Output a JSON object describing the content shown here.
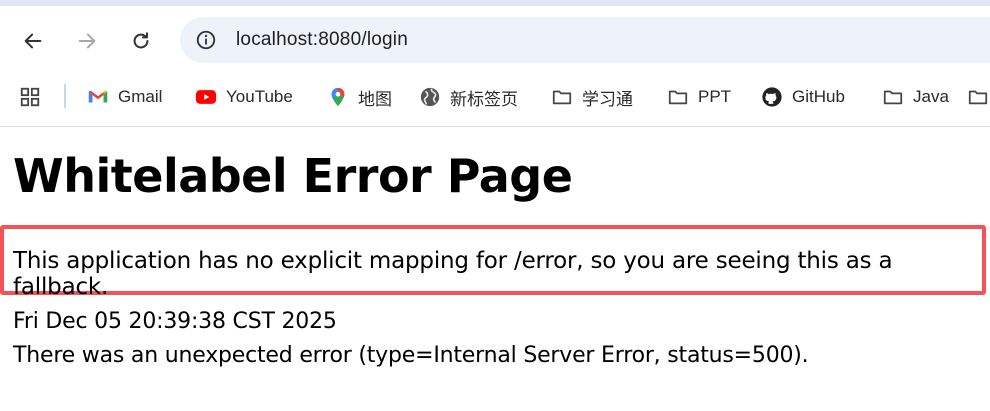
{
  "browser": {
    "url": "localhost:8080/login",
    "bookmarks": [
      {
        "label": "Gmail",
        "icon": "gmail-icon"
      },
      {
        "label": "YouTube",
        "icon": "youtube-icon"
      },
      {
        "label": "地图",
        "icon": "maps-pin-icon"
      },
      {
        "label": "新标签页",
        "icon": "globe-icon"
      },
      {
        "label": "学习通",
        "icon": "folder-icon"
      },
      {
        "label": "PPT",
        "icon": "folder-icon"
      },
      {
        "label": "GitHub",
        "icon": "github-icon"
      },
      {
        "label": "Java",
        "icon": "folder-icon"
      }
    ],
    "colors": {
      "highlight_border": "#f0545a",
      "omnibox_bg": "#eef2f9",
      "youtube_red": "#ff0000"
    }
  },
  "page": {
    "title": "Whitelabel Error Page",
    "message": "This application has no explicit mapping for /error, so you are seeing this as a fallback.",
    "timestamp": "Fri Dec 05 20:39:38 CST 2025",
    "error": "There was an unexpected error (type=Internal Server Error, status=500)."
  }
}
